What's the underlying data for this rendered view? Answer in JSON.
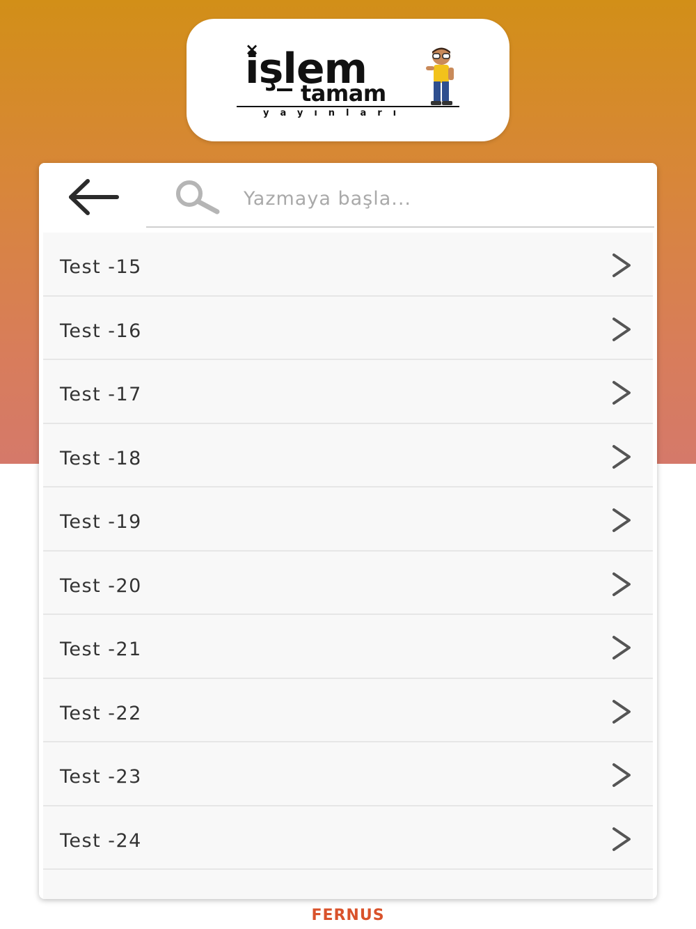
{
  "brand": {
    "logo_x": "×",
    "logo_main": "işlem",
    "logo_sub": "tamam",
    "logo_tag": "yayınları"
  },
  "search": {
    "placeholder": "Yazmaya başla..."
  },
  "icons": {
    "back": "arrow-left-icon",
    "search": "magnifier-icon",
    "row_chevron": "chevron-right-icon"
  },
  "list": {
    "items": [
      {
        "label": "Test -15"
      },
      {
        "label": "Test -16"
      },
      {
        "label": "Test -17"
      },
      {
        "label": "Test -18"
      },
      {
        "label": "Test -19"
      },
      {
        "label": "Test -20"
      },
      {
        "label": "Test -21"
      },
      {
        "label": "Test -22"
      },
      {
        "label": "Test -23"
      },
      {
        "label": "Test -24"
      }
    ]
  },
  "footer": {
    "text": "FERNUS"
  },
  "colors": {
    "gradient_top": "#d28f18",
    "gradient_bottom": "#d5796a",
    "footer_brand": "#d9522b",
    "row_bg": "#f8f8f8"
  }
}
